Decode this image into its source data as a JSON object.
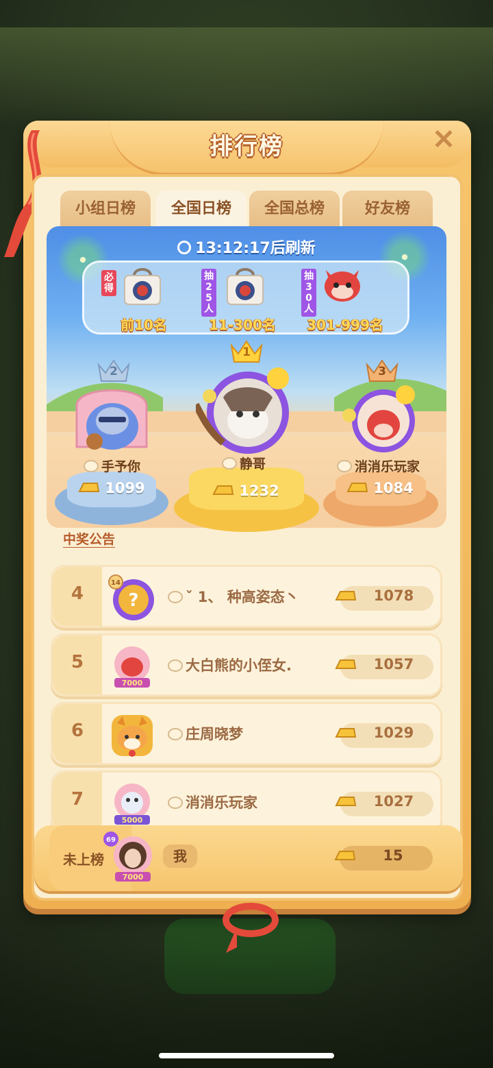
{
  "title": "排行榜",
  "tabs": [
    {
      "label": "小组日榜",
      "active": false
    },
    {
      "label": "全国日榜",
      "active": true
    },
    {
      "label": "全国总榜",
      "active": false
    },
    {
      "label": "好友榜",
      "active": false
    }
  ],
  "countdown": "13:12:17后刷新",
  "prizes": [
    {
      "tag": "必得",
      "label": "前10名",
      "icon": "prize-bag-icon"
    },
    {
      "tag": "抽25人",
      "label": "11-300名",
      "icon": "prize-bag-icon"
    },
    {
      "tag": "抽30人",
      "label": "301-999名",
      "icon": "fox-plush-icon"
    }
  ],
  "podium": [
    {
      "rank": "2",
      "name": "手予你",
      "score": "1099"
    },
    {
      "rank": "1",
      "name": "静哥",
      "score": "1232"
    },
    {
      "rank": "3",
      "name": "消消乐玩家",
      "score": "1084"
    }
  ],
  "announcement": "中奖公告",
  "rows": [
    {
      "rank": "4",
      "name": "ˇ 1、 种高姿态丶",
      "score": "1078",
      "badge": "14"
    },
    {
      "rank": "5",
      "name": "大白熊的小侄女.",
      "score": "1057",
      "badge": "7000"
    },
    {
      "rank": "6",
      "name": "庄周晓梦",
      "score": "1029",
      "badge": ""
    },
    {
      "rank": "7",
      "name": "消消乐玩家",
      "score": "1027",
      "badge": "5000"
    }
  ],
  "me": {
    "status": "未上榜",
    "name": "我",
    "score": "15",
    "level": "69",
    "badge": "7000"
  },
  "colors": {
    "gold": "#f4bd63",
    "cream": "#fbefd3",
    "accent_brown": "#8a5226",
    "prize_yellow": "#ffd955"
  }
}
